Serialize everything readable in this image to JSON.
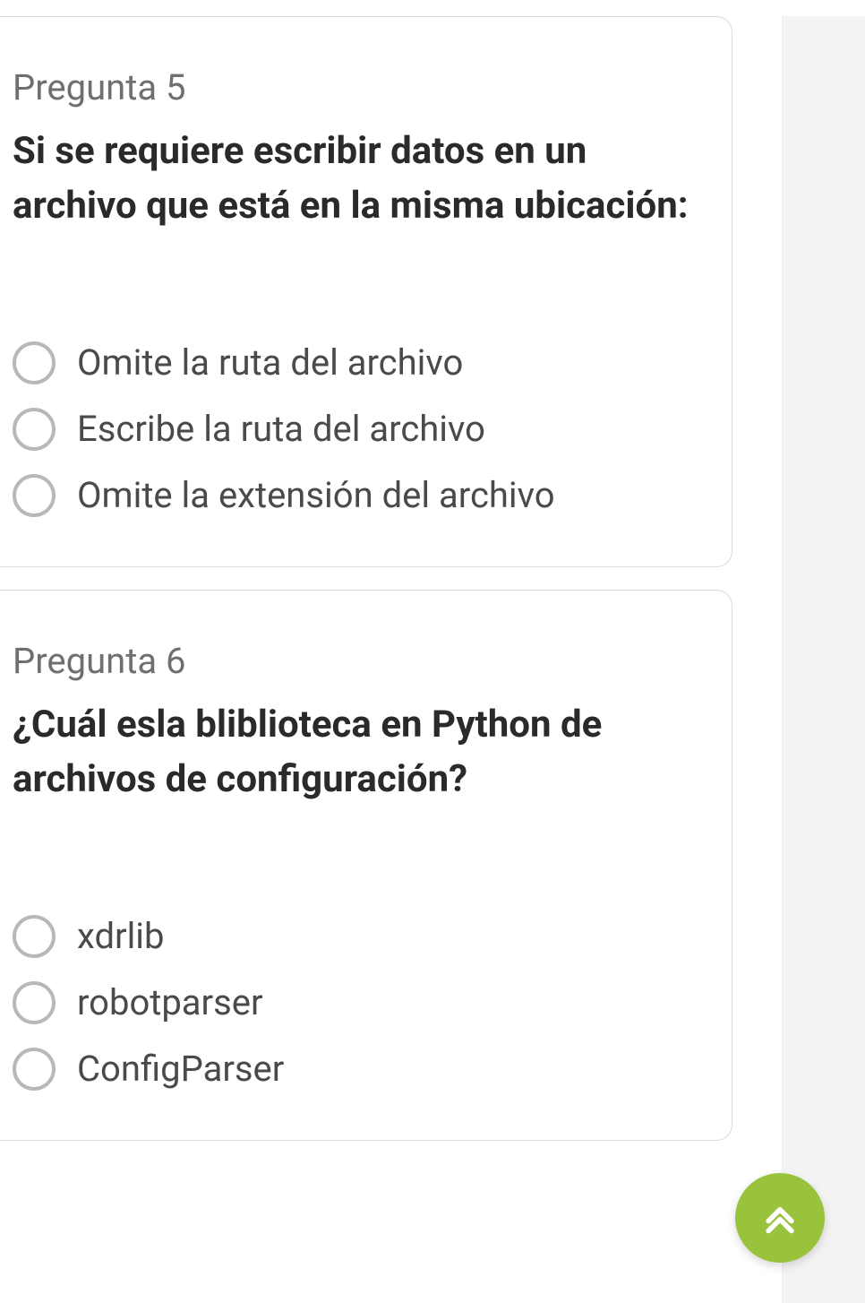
{
  "questions": [
    {
      "label": "Pregunta 5",
      "text": "Si se requiere escribir datos en un archivo que está en la misma ubicación:",
      "options": [
        "Omite la ruta del archivo",
        "Escribe la ruta del archivo",
        "Omite la extensión del archivo"
      ]
    },
    {
      "label": "Pregunta 6",
      "text": "¿Cuál esla bliblioteca en Python de archivos de configuración?",
      "options": [
        "xdrlib",
        "robotparser",
        "ConfigParser"
      ]
    }
  ],
  "fab": {
    "icon": "scroll-top"
  }
}
